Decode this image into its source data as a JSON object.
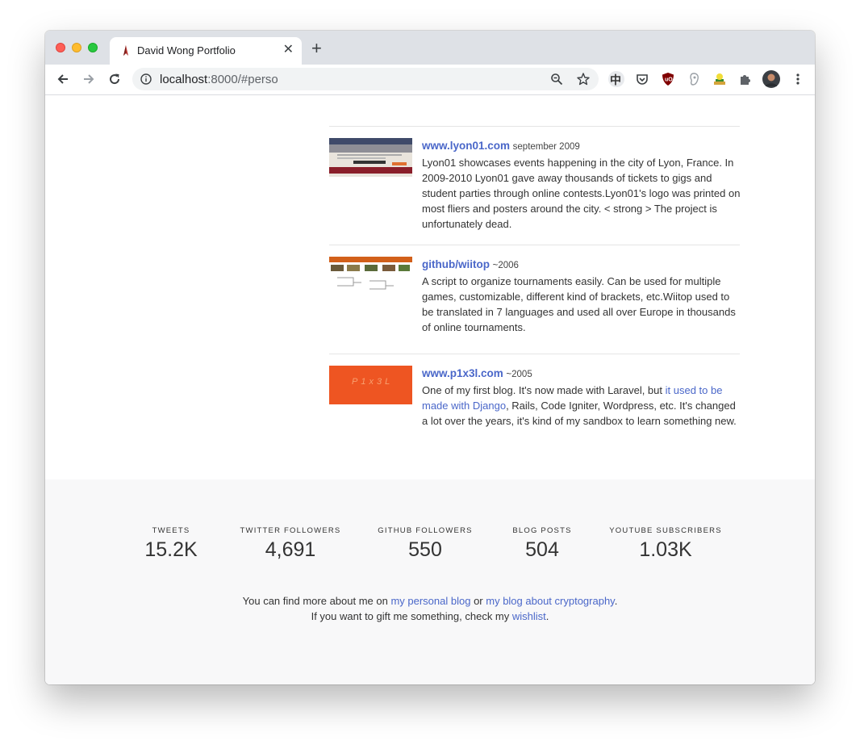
{
  "browser": {
    "tab_title": "David Wong Portfolio",
    "new_tab": "+",
    "tab_close": "✕",
    "url_host": "localhost",
    "url_rest": ":8000/#perso",
    "extension_1": "中"
  },
  "projects": [
    {
      "title": "www.lyon01.com",
      "date": "september 2009",
      "description": "Lyon01 showcases events happening in the city of Lyon, France. In 2009-2010 Lyon01 gave away thousands of tickets to gigs and student parties through online contests.Lyon01's logo was printed on most fliers and posters around the city. < strong > The project is unfortunately dead."
    },
    {
      "title": "github/wiitop",
      "date": "~2006",
      "description": "A script to organize tournaments easily. Can be used for multiple games, customizable, different kind of brackets, etc.Wiitop used to be translated in 7 languages and used all over Europe in thousands of online tournaments."
    },
    {
      "title": "www.p1x3l.com",
      "date": "~2005",
      "desc_before": "One of my first blog. It's now made with Laravel, but ",
      "desc_link": "it used to be made with Django",
      "desc_after": ", Rails, Code Igniter, Wordpress, etc. It's changed a lot over the years, it's kind of my sandbox to learn something new.",
      "thumb_text": "P1x3L"
    }
  ],
  "stats": [
    {
      "label": "TWEETS",
      "value": "15.2K"
    },
    {
      "label": "TWITTER FOLLOWERS",
      "value": "4,691"
    },
    {
      "label": "GITHUB FOLLOWERS",
      "value": "550"
    },
    {
      "label": "BLOG POSTS",
      "value": "504"
    },
    {
      "label": "YOUTUBE SUBSCRIBERS",
      "value": "1.03K"
    }
  ],
  "footer": {
    "line1_before": "You can find more about me on ",
    "link_blog": "my personal blog",
    "line1_mid": " or ",
    "link_crypto": "my blog about cryptography",
    "line1_after": ".",
    "line2_before": "If you want to gift me something, check my ",
    "link_wishlist": "wishlist",
    "line2_after": "."
  },
  "colors": {
    "link": "#4a67c9",
    "footer_bg": "#f8f8f9",
    "p1x3l_orange": "#ee5522"
  }
}
